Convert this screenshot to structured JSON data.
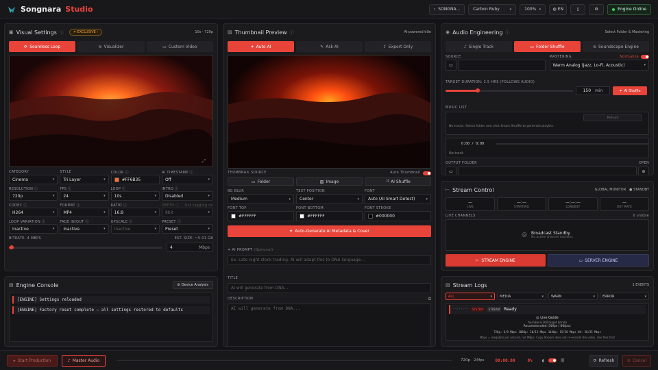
{
  "app": {
    "brand_primary": "Songnara",
    "brand_accent": "Studio",
    "accent_color": "#e8443a"
  },
  "topbar": {
    "project": "SONGNA...",
    "theme": "Carbon Ruby",
    "zoom": "100%",
    "lang": "EN",
    "engine_status": "Engine Online"
  },
  "visual": {
    "title": "Visual Settings",
    "badge": "EXCLUSIVE",
    "range": "10s - 720p",
    "tabs": [
      "Seamless Loop",
      "Visualizer",
      "Custom Video"
    ],
    "labels": {
      "category": "CATEGORY",
      "style": "STYLE",
      "color": "COLOR",
      "timestamp": "AI TIMESTAMP",
      "resolution": "RESOLUTION",
      "fps": "FPS",
      "loop": "LOOP",
      "intro": "INTRO",
      "codec": "CODEC",
      "format": "FORMAT",
      "ratio": "RATIO",
      "depth": "DEPTH",
      "loopvar": "LOOP VARIATION",
      "fade": "FADE IN/OUT",
      "upscale": "UPSCALE",
      "preset": "PRESET"
    },
    "values": {
      "category": "Cinema",
      "style": "Tri Layer",
      "color": "#FF6B35",
      "timestamp": "Off",
      "resolution": "720p",
      "fps": "24",
      "loop": "10s",
      "intro": "Disabled",
      "codec": "H264",
      "format": "MP4",
      "ratio": "16:9",
      "depth": "8bit",
      "loopvar": "Inactive",
      "fade": "Inactive",
      "upscale": "Inactive",
      "preset": "Preset"
    },
    "depth_note": "Dot tagging on",
    "bitrate_label": "BITRATE: 4 MBPS",
    "est_size": "EST. SIZE: ~5.01 GB",
    "bitrate_value": "4",
    "bitrate_unit": "Mbps",
    "bitrate_fraction": 0.02
  },
  "console": {
    "title": "Engine Console",
    "action": "Device Analysis",
    "lines": [
      "[ENGINE] Settings reloaded",
      "[ENGINE] Factory reset complete — all settings restored to defaults"
    ]
  },
  "thumb": {
    "title": "Thumbnail Preview",
    "right": "AI-powered title",
    "tabs": [
      "Auto AI",
      "Ask AI",
      "Export Only"
    ],
    "source_label": "THUMBNAIL SOURCE",
    "auto_label": "Auto Thumbnail",
    "source_opts": [
      "Folder",
      "Image",
      "AI Shuffle"
    ],
    "labels": {
      "bgblur": "BG BLUR",
      "textpos": "TEXT POSITION",
      "font": "FONT",
      "fonttop": "FONT TOP",
      "fontbottom": "FONT BOTTOM",
      "fontstroke": "FONT STROKE"
    },
    "values": {
      "bgblur": "Medium",
      "textpos": "Center",
      "font": "Auto (AI Smart Detect)",
      "fonttop": "#FFFFFF",
      "fontbottom": "#FFFFFF",
      "fontstroke": "#000000"
    },
    "generate": "Auto-Generate AI Metadata & Cover",
    "prompt_label": "AI PROMPT",
    "prompt_opt": "(Optional)",
    "prompt_placeholder": "Ex. Late night stock trading. AI will adapt this to DNA language...",
    "title_label": "TITLE",
    "title_placeholder": "AI will generate from DNA...",
    "desc_label": "DESCRIPTION",
    "desc_placeholder": "AI will generate from DNA..."
  },
  "audio": {
    "title": "Audio Engineering",
    "right": "Select Folder & Mastering",
    "tabs": [
      "Single Track",
      "Folder Shuffle",
      "Soundscape Engine"
    ],
    "source_label": "SOURCE",
    "mastering_label": "MASTERING",
    "normalize": "Normalize",
    "mastering_value": "Warm Analog (Jazz, Lo-Fi, Acoustic)",
    "duration_label": "TARGET DURATION: 2.5 HRS (FOLLOWS AUDIO)",
    "duration_value": "150",
    "duration_unit": "min",
    "shuffle": "AI Shuffle",
    "duration_fraction": 0.25,
    "music_label": "MUSIC LIST",
    "reload": "Reload",
    "music_empty": "No tracks. Select folder and click Smart Shuffle to generate playlist.",
    "time": "0:00 / 0:00",
    "no_track": "No track",
    "output_label": "OUTPUT FOLDER",
    "open": "OPEN"
  },
  "stream": {
    "title": "Stream Control",
    "global": "GLOBAL MONITOR",
    "standby": "STANDBY",
    "stats": [
      {
        "v": "—",
        "l": "LIVE"
      },
      {
        "v": "—:—",
        "l": "STARTING"
      },
      {
        "v": "—:—:—",
        "l": "LONGEST"
      },
      {
        "v": "—",
        "l": "OUT RATE"
      }
    ],
    "channels_label": "LIVE CHANNELS",
    "channels_count": "0 visible",
    "standby_title": "Broadcast Standby",
    "standby_sub": "No active channel sessions",
    "stream_btn": "STREAM ENGINE",
    "server_btn": "SERVER ENGINE"
  },
  "logs": {
    "title": "Stream Logs",
    "count": "1 EVENTS",
    "filters": [
      "ALL",
      "MEDIA",
      "WARN",
      "ERROR"
    ],
    "entry": {
      "time": "--:--:--",
      "tag1": "SYSTEM",
      "tag2": "STREAM",
      "msg": "Ready"
    },
    "guide_title": "Live Guide",
    "guide_sub": "YouTube H.264 target bitrate",
    "guide_rec": "Recommended (30fps / 60fps):",
    "guide_rates": "720p: 6/9 Mbps   1080p: 10/12 Mbps   1440p: 15/20 Mbps   4K: 30/35 Mbps",
    "guide_note": "Mbps = megabits per second, not MBps. Copy Stream does not re-encode the video. Use files that"
  },
  "bottom": {
    "start": "Start Production",
    "master": "Master Audio",
    "resfps": "720p · 24fps",
    "timer": "00:00:00",
    "percent": "0%",
    "refresh": "Refresh",
    "cancel": "Cancel"
  }
}
